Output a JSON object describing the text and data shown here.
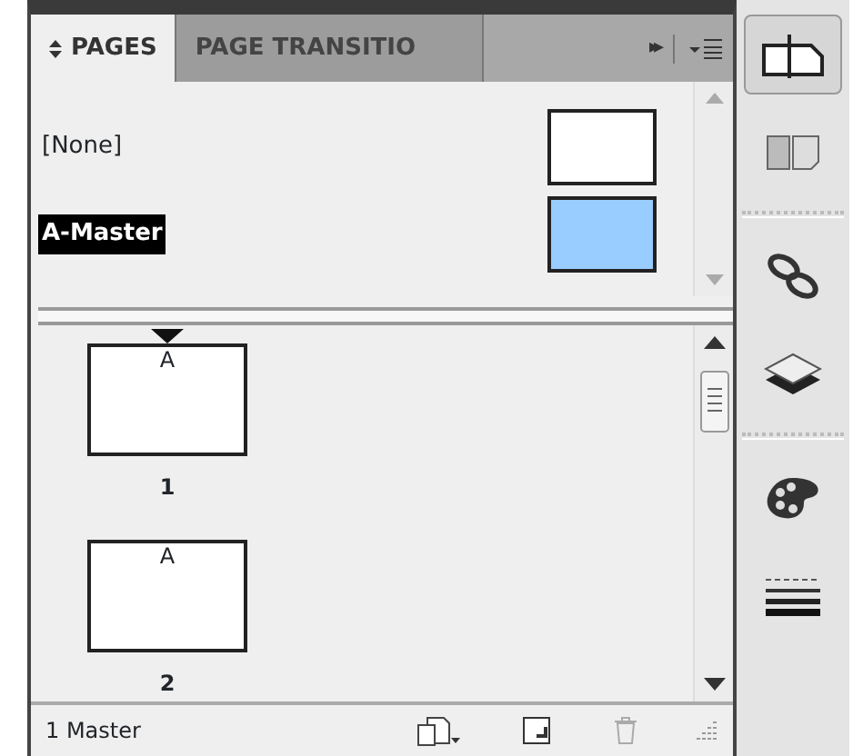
{
  "tabs": [
    {
      "label": "PAGES",
      "selected": true
    },
    {
      "label": "PAGE TRANSITIO",
      "selected": false
    }
  ],
  "overflow_button": "▸▸",
  "masters": [
    {
      "name": "[None]",
      "selected": false,
      "color": "#ffffff"
    },
    {
      "name": "A-Master",
      "selected": true,
      "color": "#99ccff"
    }
  ],
  "pages": [
    {
      "master": "A",
      "number": "1"
    },
    {
      "master": "A",
      "number": "2"
    }
  ],
  "status_bar": {
    "text": "1 Master",
    "delete_disabled": true
  },
  "toolbar": [
    {
      "kind": "pages",
      "selected": true
    },
    {
      "kind": "spread",
      "selected": false
    },
    {
      "kind": "sep"
    },
    {
      "kind": "links",
      "selected": false
    },
    {
      "kind": "layers",
      "selected": false
    },
    {
      "kind": "sep"
    },
    {
      "kind": "swatches",
      "selected": false
    },
    {
      "kind": "stroke",
      "selected": false
    }
  ]
}
